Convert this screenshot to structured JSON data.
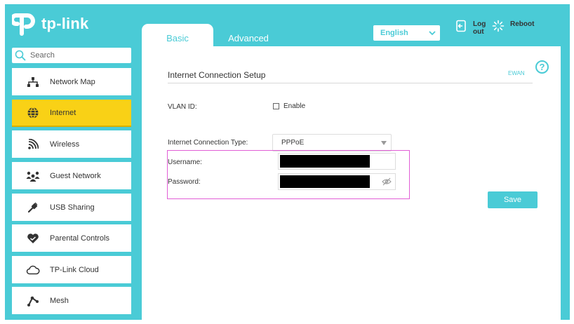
{
  "brand": {
    "logo_text": "tp-link"
  },
  "header": {
    "tabs": [
      {
        "label": "Basic",
        "active": true
      },
      {
        "label": "Advanced",
        "active": false
      }
    ],
    "language": "English",
    "logout_label": "Log out",
    "reboot_label": "Reboot"
  },
  "sidebar": {
    "search_placeholder": "Search",
    "items": [
      {
        "label": "Network Map",
        "icon": "network-map-icon"
      },
      {
        "label": "Internet",
        "icon": "globe-icon",
        "active": true
      },
      {
        "label": "Wireless",
        "icon": "wireless-icon"
      },
      {
        "label": "Guest Network",
        "icon": "guest-network-icon"
      },
      {
        "label": "USB Sharing",
        "icon": "usb-icon"
      },
      {
        "label": "Parental Controls",
        "icon": "parental-controls-icon"
      },
      {
        "label": "TP-Link Cloud",
        "icon": "cloud-icon"
      },
      {
        "label": "Mesh",
        "icon": "mesh-icon"
      }
    ]
  },
  "main": {
    "section_title": "Internet Connection Setup",
    "section_tag": "EWAN",
    "vlan_label": "VLAN ID:",
    "vlan_enable_label": "Enable",
    "connection_type_label": "Internet Connection Type:",
    "connection_type_value": "PPPoE",
    "username_label": "Username:",
    "password_label": "Password:",
    "save_label": "Save"
  },
  "colors": {
    "brand": "#4acbd6",
    "active_item": "#f9d116",
    "highlight_box": "#e15ed6"
  }
}
